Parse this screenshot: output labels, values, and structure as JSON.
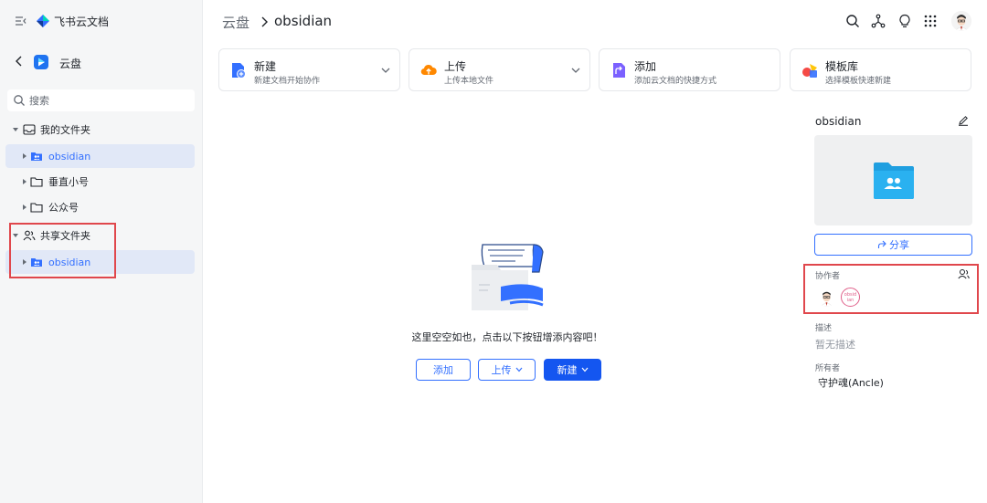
{
  "brand": "飞书云文档",
  "sidebar": {
    "title": "云盘",
    "search_placeholder": "搜索",
    "tree": [
      {
        "label": "我的文件夹",
        "type": "section"
      },
      {
        "label": "obsidian",
        "type": "shared-folder",
        "active": true
      },
      {
        "label": "垂直小号",
        "type": "folder"
      },
      {
        "label": "公众号",
        "type": "folder"
      },
      {
        "label": "共享文件夹",
        "type": "section"
      },
      {
        "label": "obsidian",
        "type": "shared-folder",
        "active": true
      }
    ]
  },
  "breadcrumb": {
    "root": "云盘",
    "current": "obsidian"
  },
  "header_icons": [
    "search-icon",
    "graph-icon",
    "lightbulb-icon",
    "apps-grid-icon",
    "user-avatar"
  ],
  "actions": [
    {
      "title": "新建",
      "subtitle": "新建文档开始协作",
      "icon": "new-doc-icon",
      "dropdown": true
    },
    {
      "title": "上传",
      "subtitle": "上传本地文件",
      "icon": "upload-cloud-icon",
      "dropdown": true
    },
    {
      "title": "添加",
      "subtitle": "添加云文档的快捷方式",
      "icon": "shortcut-icon",
      "dropdown": false
    },
    {
      "title": "模板库",
      "subtitle": "选择模板快速新建",
      "icon": "template-icon",
      "dropdown": false
    }
  ],
  "empty_state": {
    "message": "这里空空如也，点击以下按钮增添内容吧！",
    "buttons": {
      "add": "添加",
      "upload": "上传",
      "create": "新建"
    }
  },
  "details": {
    "name": "obsidian",
    "share_label": "分享",
    "collaborators_label": "协作者",
    "collaborator_badge": "obsidian",
    "description_label": "描述",
    "description_value": "暂无描述",
    "owner_label": "所有者",
    "owner_value": "守护魂(Ancle)"
  },
  "colors": {
    "accent": "#3370ff",
    "primary_button": "#1456f0",
    "highlight_box": "#e0474c",
    "sidebar_bg": "#f5f6f7",
    "active_row": "#e1e8f7"
  }
}
